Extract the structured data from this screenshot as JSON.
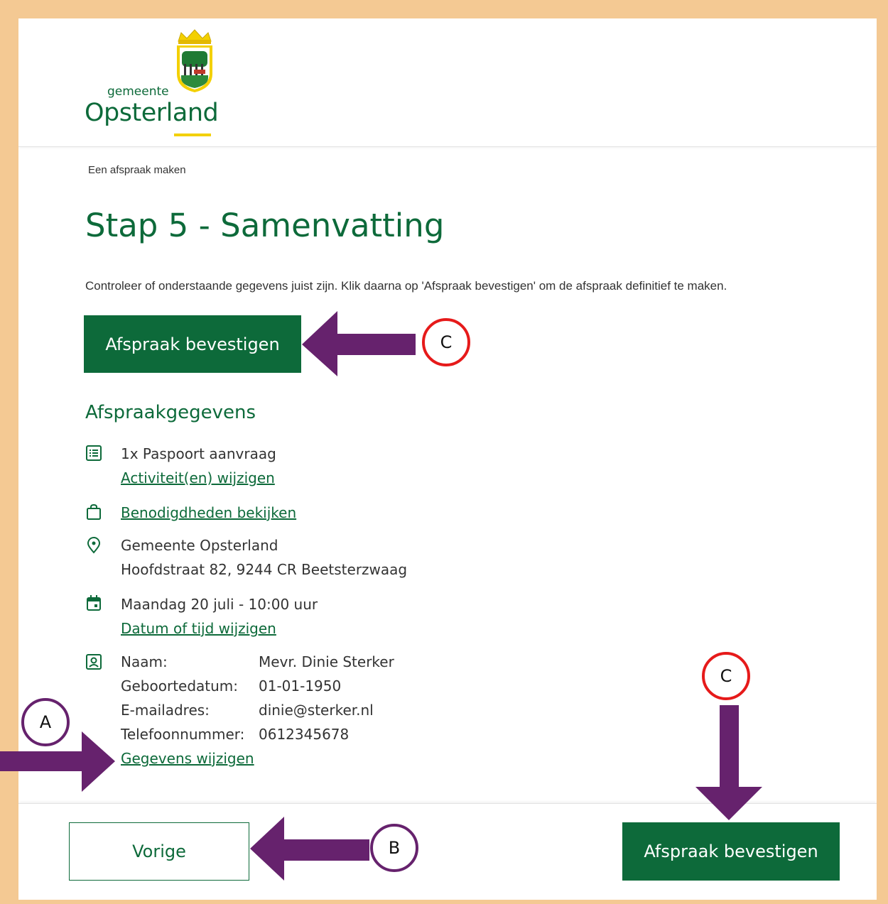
{
  "header": {
    "logo_small": "gemeente",
    "logo_name": "Opsterland"
  },
  "breadcrumb": "Een afspraak maken",
  "page_title": "Stap 5 - Samenvatting",
  "intro_text": "Controleer of onderstaande gegevens juist zijn. Klik daarna op 'Afspraak bevestigen' om de afspraak definitief te maken.",
  "confirm_label": "Afspraak bevestigen",
  "section_title": "Afspraakgegevens",
  "details": {
    "activity": "1x Paspoort aanvraag",
    "activity_link": "Activiteit(en) wijzigen",
    "needs_link": "Benodigdheden bekijken",
    "location_name": "Gemeente Opsterland",
    "location_address": "Hoofdstraat 82, 9244 CR Beetsterzwaag",
    "datetime": "Maandag 20 juli - 10:00 uur",
    "datetime_link": "Datum of tijd wijzigen",
    "person": [
      {
        "label": "Naam:",
        "value": "Mevr. Dinie Sterker"
      },
      {
        "label": "Geboortedatum:",
        "value": "01-01-1950"
      },
      {
        "label": "E-mailadres:",
        "value": "dinie@sterker.nl"
      },
      {
        "label": "Telefoonnummer:",
        "value": "0612345678"
      }
    ],
    "person_link": "Gegevens wijzigen"
  },
  "footer": {
    "previous_label": "Vorige",
    "confirm_label": "Afspraak bevestigen"
  },
  "annotations": {
    "marker_a": "A",
    "marker_b": "B",
    "marker_c_top": "C",
    "marker_c_bottom": "C"
  },
  "colors": {
    "brand_green": "#0d6a3a",
    "frame": "#f4c993",
    "arrow": "#66226d",
    "marker_red": "#e61a1a",
    "logo_yellow": "#f3d000"
  },
  "icons": {
    "activity": "list-icon",
    "needs": "bag-icon",
    "location": "location-pin-icon",
    "date": "calendar-icon",
    "person": "person-card-icon"
  }
}
